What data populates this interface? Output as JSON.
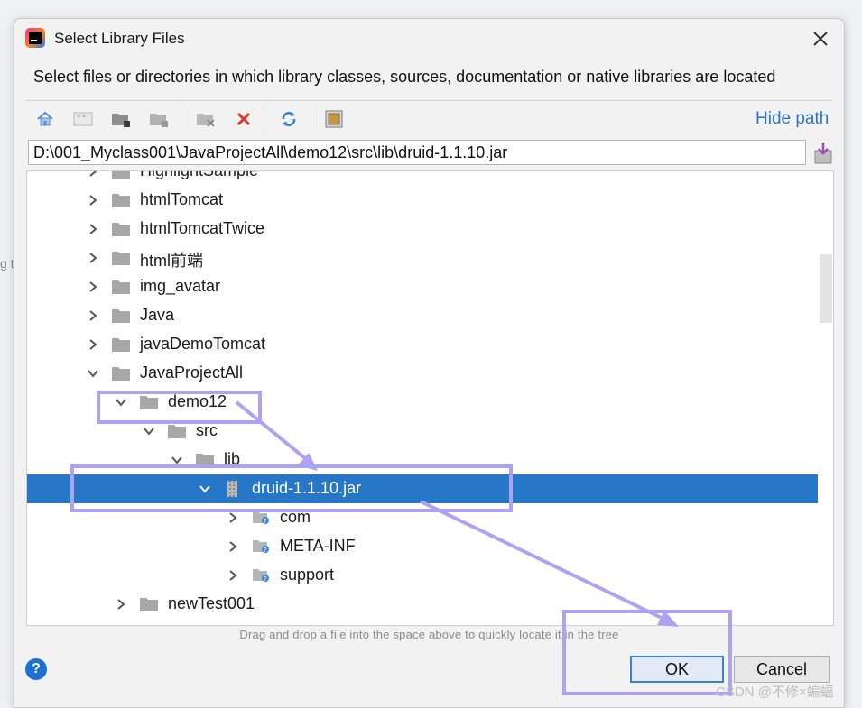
{
  "dialog": {
    "title": "Select Library Files",
    "description": "Select files or directories in which library classes, sources, documentation or native libraries are located",
    "hide_path_label": "Hide path",
    "path_value": "D:\\001_Myclass001\\JavaProjectAll\\demo12\\src\\lib\\druid-1.1.10.jar",
    "drag_hint": "Drag and drop a file into the space above to quickly locate it in the tree",
    "ok_label": "OK",
    "cancel_label": "Cancel",
    "help_glyph": "?"
  },
  "toolbar": {
    "buttons": [
      "home-icon",
      "desktop-icon",
      "new-folder-icon",
      "folder-icon",
      "module-icon",
      "delete-icon",
      "refresh-icon",
      "show-hidden-icon"
    ]
  },
  "tree": {
    "items": [
      {
        "label": "HighlightSample",
        "depth": 0,
        "expanded": false,
        "kind": "folder"
      },
      {
        "label": "htmlTomcat",
        "depth": 0,
        "expanded": false,
        "kind": "folder"
      },
      {
        "label": "htmlTomcatTwice",
        "depth": 0,
        "expanded": false,
        "kind": "folder"
      },
      {
        "label": "html前端",
        "depth": 0,
        "expanded": false,
        "kind": "folder"
      },
      {
        "label": "img_avatar",
        "depth": 0,
        "expanded": false,
        "kind": "folder"
      },
      {
        "label": "Java",
        "depth": 0,
        "expanded": false,
        "kind": "folder"
      },
      {
        "label": "javaDemoTomcat",
        "depth": 0,
        "expanded": false,
        "kind": "folder"
      },
      {
        "label": "JavaProjectAll",
        "depth": 0,
        "expanded": true,
        "kind": "folder"
      },
      {
        "label": "demo12",
        "depth": 1,
        "expanded": true,
        "kind": "folder"
      },
      {
        "label": "src",
        "depth": 2,
        "expanded": true,
        "kind": "folder"
      },
      {
        "label": "lib",
        "depth": 3,
        "expanded": true,
        "kind": "folder"
      },
      {
        "label": "druid-1.1.10.jar",
        "depth": 4,
        "expanded": true,
        "kind": "jar",
        "selected": true
      },
      {
        "label": "com",
        "depth": 5,
        "expanded": false,
        "kind": "package"
      },
      {
        "label": "META-INF",
        "depth": 5,
        "expanded": false,
        "kind": "package"
      },
      {
        "label": "support",
        "depth": 5,
        "expanded": false,
        "kind": "package"
      },
      {
        "label": "newTest001",
        "depth": 1,
        "expanded": false,
        "kind": "folder"
      }
    ]
  },
  "backdrop": {
    "side_text": "g t"
  },
  "watermark": "CSDN @不修×蝙蝠",
  "colors": {
    "selection": "#2677c8",
    "accent_link": "#2d73c6",
    "annotation": "#a99cf4"
  }
}
